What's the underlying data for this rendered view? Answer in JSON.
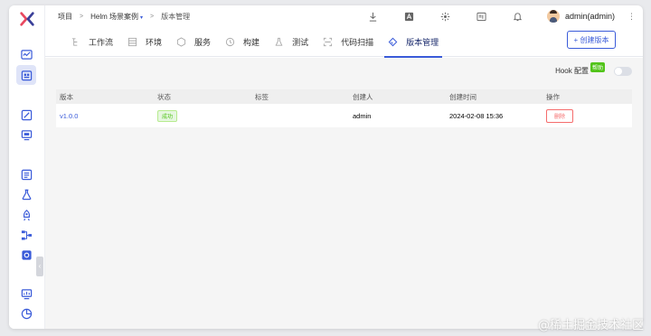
{
  "breadcrumb": {
    "root": "项目",
    "sep1": ">",
    "project": "Helm 场景案例",
    "caret": "▾",
    "sep2": ">",
    "current": "版本管理"
  },
  "user": {
    "name": "admin(admin)",
    "more": "⋮"
  },
  "tabs": [
    {
      "label": "工作流",
      "icon": "workflow-icon"
    },
    {
      "label": "环境",
      "icon": "environment-icon"
    },
    {
      "label": "服务",
      "icon": "service-icon"
    },
    {
      "label": "构建",
      "icon": "build-icon"
    },
    {
      "label": "测试",
      "icon": "test-icon"
    },
    {
      "label": "代码扫描",
      "icon": "code-scan-icon"
    },
    {
      "label": "版本管理",
      "icon": "version-icon",
      "active": true
    }
  ],
  "create_button": "+ 创建版本",
  "hook": {
    "label": "Hook 配置",
    "badge": "帮助",
    "enabled": false
  },
  "table": {
    "headers": [
      "版本",
      "状态",
      "标签",
      "创建人",
      "创建时间",
      "操作"
    ],
    "rows": [
      {
        "version": "v1.0.0",
        "status": "成功",
        "tag": "",
        "creator": "admin",
        "created_at": "2024-02-08 15:36",
        "action": "删除"
      }
    ]
  },
  "watermark": "@稀土掘金技术社区",
  "colors": {
    "accent": "#3a5bd9",
    "success": "#52c41a",
    "danger": "#f56c6c",
    "logo": "#e8475f"
  }
}
